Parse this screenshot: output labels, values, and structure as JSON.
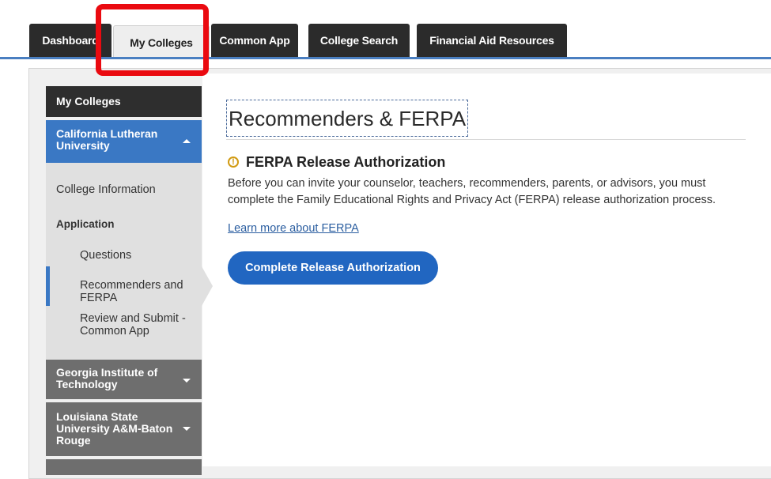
{
  "tabs": [
    {
      "label": "Dashboard"
    },
    {
      "label": "My Colleges"
    },
    {
      "label": "Common App"
    },
    {
      "label": "College Search"
    },
    {
      "label": "Financial Aid Resources"
    }
  ],
  "sidebar": {
    "header": "My Colleges",
    "active_college": "California Lutheran University",
    "items": {
      "college_info": "College Information",
      "application": "Application",
      "questions": "Questions",
      "recommenders": "Recommenders and FERPA",
      "review": "Review and Submit - Common App"
    },
    "other_colleges": [
      "Georgia Institute of Technology",
      "Louisiana State University A&M-Baton Rouge"
    ]
  },
  "main": {
    "title": "Recommenders & FERPA",
    "notice": {
      "heading": "FERPA Release Authorization",
      "body": "Before you can invite your counselor, teachers, recommenders, parents, or advisors, you must complete the Family Educational Rights and Privacy Act (FERPA) release authorization process.",
      "link": "Learn more about FERPA",
      "button": "Complete Release Authorization"
    }
  },
  "colors": {
    "tab_dark": "#2b2b2b",
    "accent_blue": "#3a78c4",
    "button_blue": "#2166c1",
    "highlight_red": "#ea0a10",
    "warning": "#d19a12"
  }
}
